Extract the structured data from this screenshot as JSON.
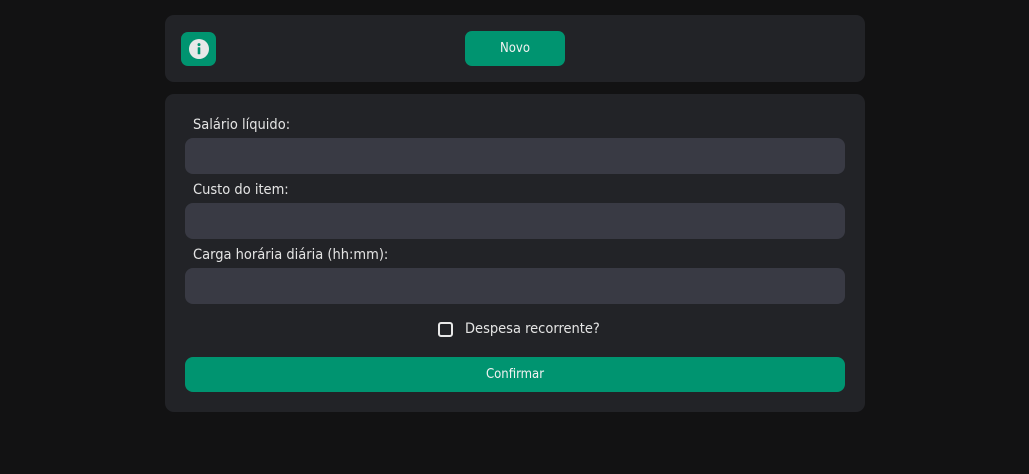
{
  "colors": {
    "page_background": "#121213",
    "card_background": "#222327",
    "input_background": "#393a44",
    "accent": "#009470",
    "text": "#e4e4e4"
  },
  "toolbar": {
    "info_icon": "info-circle-icon",
    "new_label": "Novo"
  },
  "form": {
    "fields": [
      {
        "label": "Salário líquido:",
        "value": "",
        "placeholder": ""
      },
      {
        "label": "Custo do item:",
        "value": "",
        "placeholder": ""
      },
      {
        "label": "Carga horária diária (hh:mm):",
        "value": "",
        "placeholder": ""
      }
    ],
    "recurring": {
      "label": "Despesa recorrente?",
      "checked": false
    },
    "confirm_label": "Confirmar"
  }
}
